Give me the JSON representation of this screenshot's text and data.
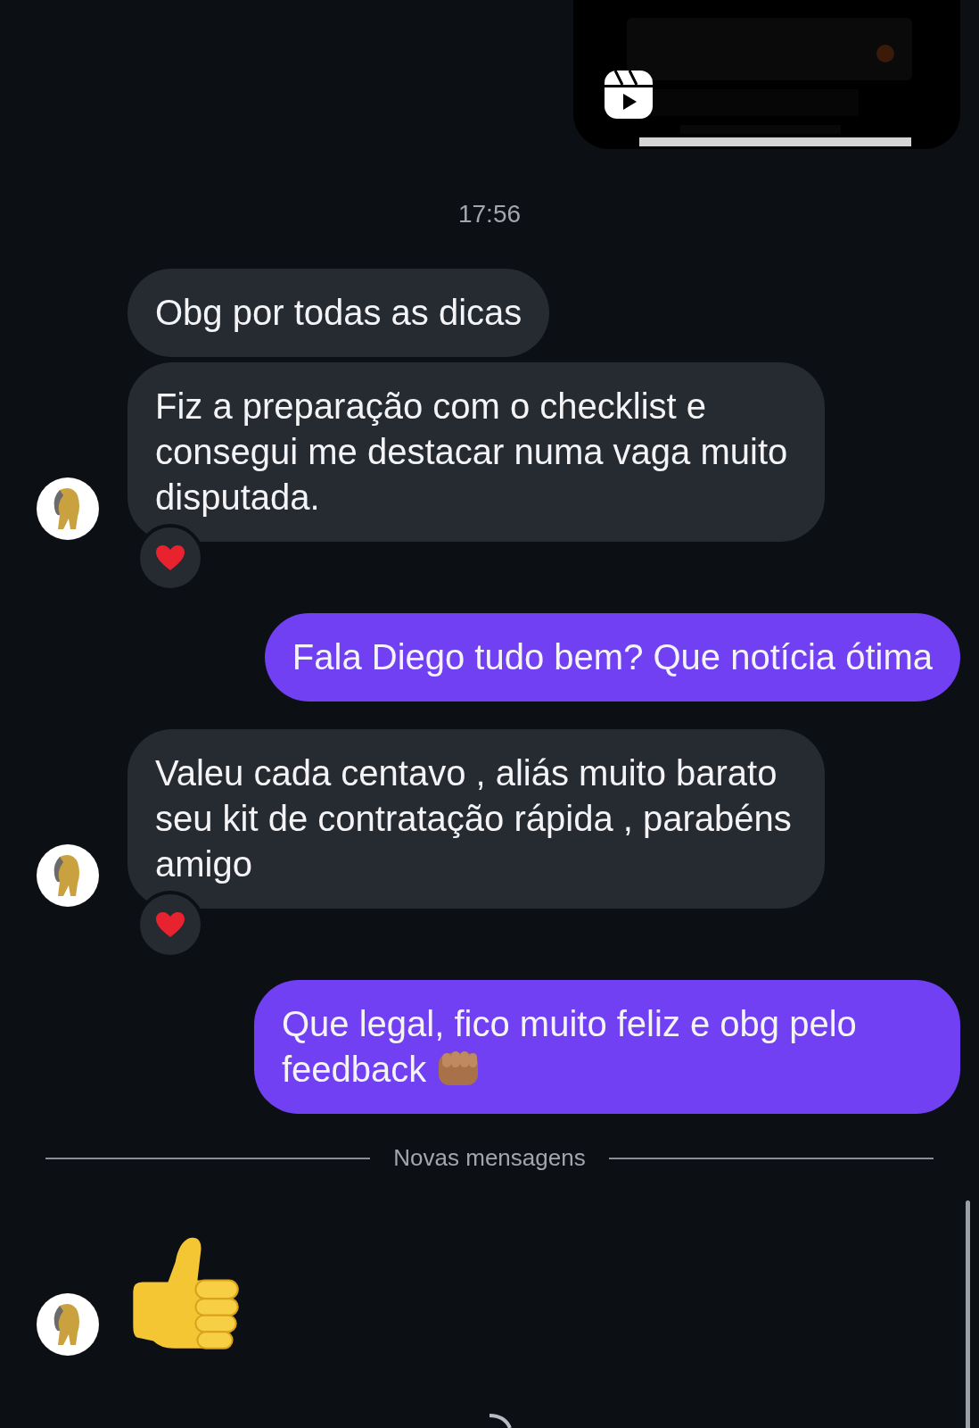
{
  "timestamp": "17:56",
  "groups": [
    {
      "kind": "incoming",
      "messages": [
        {
          "kind": "text",
          "text": "Obg por todas as dicas",
          "reacted": false
        },
        {
          "kind": "text",
          "text": "Fiz a preparação com o checklist e consegui me destacar numa vaga muito disputada.",
          "reacted": true
        }
      ]
    },
    {
      "kind": "outgoing",
      "messages": [
        {
          "kind": "text",
          "text": "Fala Diego tudo bem? Que notícia ótima",
          "fist_emoji": false
        }
      ]
    },
    {
      "kind": "incoming",
      "messages": [
        {
          "kind": "text",
          "text": "Valeu cada centavo , aliás muito barato seu kit de contratação rápida , parabéns amigo",
          "reacted": true
        }
      ]
    },
    {
      "kind": "outgoing",
      "messages": [
        {
          "kind": "text",
          "text": "Que legal, fico muito feliz e obg pelo feedback",
          "fist_emoji": true
        }
      ]
    }
  ],
  "divider": "Novas mensagens",
  "last_group": {
    "kind": "incoming",
    "messages": [
      {
        "kind": "sticker"
      }
    ]
  }
}
